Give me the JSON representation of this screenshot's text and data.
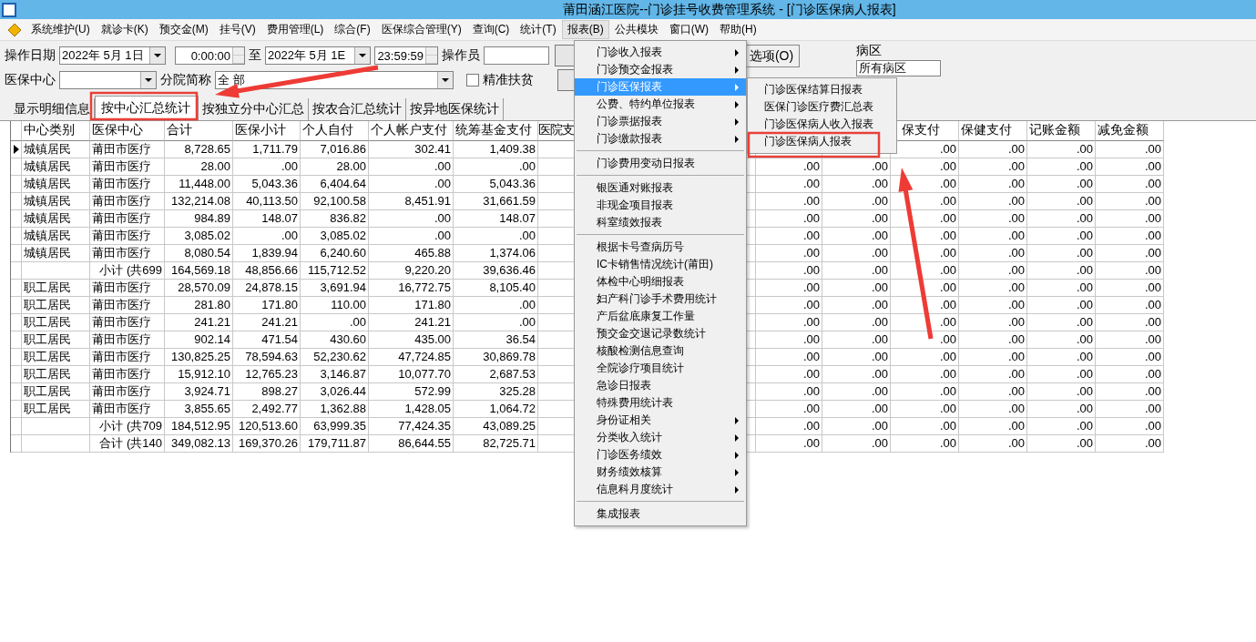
{
  "window": {
    "title": "莆田涵江医院--门诊挂号收费管理系统 - [门诊医保病人报表]"
  },
  "menubar": [
    {
      "label": "系统维护(U)",
      "selected": false
    },
    {
      "label": "就诊卡(K)",
      "selected": false
    },
    {
      "label": "预交金(M)",
      "selected": false
    },
    {
      "label": "挂号(V)",
      "selected": false
    },
    {
      "label": "费用管理(L)",
      "selected": false
    },
    {
      "label": "综合(F)",
      "selected": false
    },
    {
      "label": "医保综合管理(Y)",
      "selected": false
    },
    {
      "label": "查询(C)",
      "selected": false
    },
    {
      "label": "统计(T)",
      "selected": false
    },
    {
      "label": "报表(B)",
      "selected": true
    },
    {
      "label": "公共模块",
      "selected": false
    },
    {
      "label": "窗口(W)",
      "selected": false
    },
    {
      "label": "帮助(H)",
      "selected": false
    }
  ],
  "filters": {
    "date_label": "操作日期",
    "date_from": "2022年  5月  1日",
    "time_from": "0:00:00",
    "to_label": "至",
    "date_to": "2022年  5月  1E",
    "time_to": "23:59:59",
    "operator_label": "操作员",
    "center_label": "医保中心",
    "branch_label": "分院简称",
    "branch_value": "全  部",
    "poverty_label": "精准扶贫",
    "poverty_checked": false,
    "options_button": "选项(O)",
    "ward_label": "病区",
    "ward_value": "所有病区"
  },
  "tabs": [
    {
      "label": "显示明细信息",
      "selected": false
    },
    {
      "label": "按中心汇总统计",
      "selected": true
    },
    {
      "label": "按独立分中心汇总",
      "selected": false
    },
    {
      "label": "按农合汇总统计",
      "selected": false
    },
    {
      "label": "按异地医保统计",
      "selected": false
    }
  ],
  "table": {
    "columns": [
      "中心类别",
      "医保中心",
      "合计",
      "医保小计",
      "个人自付",
      "个人帐户支付",
      "统筹基金支付",
      "医院支"
    ],
    "right_columns": [
      "保支付",
      "保健支付",
      "记账金额",
      "减免金额"
    ],
    "rows": [
      {
        "current": true,
        "category": "城镇居民",
        "center": "莆田市医疗",
        "values": [
          "8,728.65",
          "1,711.79",
          "7,016.86",
          "302.41",
          "1,409.38"
        ],
        "right": [
          ".00",
          ".00",
          ".00",
          ".00"
        ]
      },
      {
        "current": false,
        "category": "城镇居民",
        "center": "莆田市医疗",
        "values": [
          "28.00",
          ".00",
          "28.00",
          ".00",
          ".00"
        ],
        "right": [
          ".00",
          ".00",
          ".00",
          ".00",
          ".00",
          ".00"
        ]
      },
      {
        "current": false,
        "category": "城镇居民",
        "center": "莆田市医疗",
        "values": [
          "11,448.00",
          "5,043.36",
          "6,404.64",
          ".00",
          "5,043.36"
        ],
        "right": [
          ".00",
          ".00",
          ".00",
          ".00",
          ".00",
          ".00"
        ]
      },
      {
        "current": false,
        "category": "城镇居民",
        "center": "莆田市医疗",
        "values": [
          "132,214.08",
          "40,113.50",
          "92,100.58",
          "8,451.91",
          "31,661.59"
        ],
        "right": [
          ".00",
          ".00",
          ".00",
          ".00",
          ".00",
          ".00"
        ]
      },
      {
        "current": false,
        "category": "城镇居民",
        "center": "莆田市医疗",
        "values": [
          "984.89",
          "148.07",
          "836.82",
          ".00",
          "148.07"
        ],
        "right": [
          ".00",
          ".00",
          ".00",
          ".00",
          ".00",
          ".00"
        ]
      },
      {
        "current": false,
        "category": "城镇居民",
        "center": "莆田市医疗",
        "values": [
          "3,085.02",
          ".00",
          "3,085.02",
          ".00",
          ".00"
        ],
        "right": [
          ".00",
          ".00",
          ".00",
          ".00",
          ".00",
          ".00"
        ]
      },
      {
        "current": false,
        "category": "城镇居民",
        "center": "莆田市医疗",
        "values": [
          "8,080.54",
          "1,839.94",
          "6,240.60",
          "465.88",
          "1,374.06"
        ],
        "right": [
          ".00",
          ".00",
          ".00",
          ".00",
          ".00",
          ".00"
        ]
      },
      {
        "current": false,
        "center": "小计 (共699",
        "values": [
          "164,569.18",
          "48,856.66",
          "115,712.52",
          "9,220.20",
          "39,636.46"
        ],
        "right": [
          ".00",
          ".00",
          ".00",
          ".00",
          ".00",
          ".00"
        ]
      },
      {
        "current": false,
        "category": "职工居民",
        "center": "莆田市医疗",
        "values": [
          "28,570.09",
          "24,878.15",
          "3,691.94",
          "16,772.75",
          "8,105.40"
        ],
        "right": [
          ".00",
          ".00",
          ".00",
          ".00",
          ".00",
          ".00"
        ]
      },
      {
        "current": false,
        "category": "职工居民",
        "center": "莆田市医疗",
        "values": [
          "281.80",
          "171.80",
          "110.00",
          "171.80",
          ".00"
        ],
        "right": [
          ".00",
          ".00",
          ".00",
          ".00",
          ".00",
          ".00"
        ]
      },
      {
        "current": false,
        "category": "职工居民",
        "center": "莆田市医疗",
        "values": [
          "241.21",
          "241.21",
          ".00",
          "241.21",
          ".00"
        ],
        "right": [
          ".00",
          ".00",
          ".00",
          ".00",
          ".00",
          ".00"
        ]
      },
      {
        "current": false,
        "category": "职工居民",
        "center": "莆田市医疗",
        "values": [
          "902.14",
          "471.54",
          "430.60",
          "435.00",
          "36.54"
        ],
        "right": [
          ".00",
          ".00",
          ".00",
          ".00",
          ".00",
          ".00"
        ]
      },
      {
        "current": false,
        "category": "职工居民",
        "center": "莆田市医疗",
        "values": [
          "130,825.25",
          "78,594.63",
          "52,230.62",
          "47,724.85",
          "30,869.78"
        ],
        "right": [
          ".00",
          ".00",
          ".00",
          ".00",
          ".00",
          ".00"
        ]
      },
      {
        "current": false,
        "category": "职工居民",
        "center": "莆田市医疗",
        "values": [
          "15,912.10",
          "12,765.23",
          "3,146.87",
          "10,077.70",
          "2,687.53"
        ],
        "right": [
          ".00",
          ".00",
          ".00",
          ".00",
          ".00",
          ".00"
        ]
      },
      {
        "current": false,
        "category": "职工居民",
        "center": "莆田市医疗",
        "values": [
          "3,924.71",
          "898.27",
          "3,026.44",
          "572.99",
          "325.28"
        ],
        "right": [
          ".00",
          ".00",
          ".00",
          ".00",
          ".00",
          ".00"
        ]
      },
      {
        "current": false,
        "category": "职工居民",
        "center": "莆田市医疗",
        "values": [
          "3,855.65",
          "2,492.77",
          "1,362.88",
          "1,428.05",
          "1,064.72"
        ],
        "right": [
          ".00",
          ".00",
          ".00",
          ".00",
          ".00",
          ".00"
        ]
      },
      {
        "current": false,
        "center": "小计 (共709",
        "values": [
          "184,512.95",
          "120,513.60",
          "63,999.35",
          "77,424.35",
          "43,089.25"
        ],
        "right": [
          ".00",
          ".00",
          ".00",
          ".00",
          ".00",
          ".00"
        ]
      },
      {
        "current": false,
        "center": "合计 (共140",
        "values": [
          "349,082.13",
          "169,370.26",
          "179,711.87",
          "86,644.55",
          "82,725.71"
        ],
        "right": [
          ".00",
          ".00",
          ".00",
          ".00",
          ".00",
          ".00"
        ]
      }
    ]
  },
  "menu": [
    {
      "kind": "item",
      "label": "门诊收入报表",
      "submenu": true,
      "selected": false
    },
    {
      "kind": "item",
      "label": "门诊预交金报表",
      "submenu": true,
      "selected": false
    },
    {
      "kind": "item",
      "label": "门诊医保报表",
      "submenu": true,
      "selected": true
    },
    {
      "kind": "item",
      "label": "公费、特约单位报表",
      "submenu": true,
      "selected": false
    },
    {
      "kind": "item",
      "label": "门诊票据报表",
      "submenu": true,
      "selected": false
    },
    {
      "kind": "item",
      "label": "门诊缴款报表",
      "submenu": true,
      "selected": false
    },
    {
      "kind": "separator"
    },
    {
      "kind": "item",
      "label": "门诊费用变动日报表",
      "submenu": false,
      "selected": false
    },
    {
      "kind": "separator"
    },
    {
      "kind": "item",
      "label": "银医通对账报表",
      "submenu": false,
      "selected": false
    },
    {
      "kind": "item",
      "label": "非现金项目报表",
      "submenu": false,
      "selected": false
    },
    {
      "kind": "item",
      "label": "科室绩效报表",
      "submenu": false,
      "selected": false
    },
    {
      "kind": "separator"
    },
    {
      "kind": "item",
      "label": "根据卡号查病历号",
      "submenu": false,
      "selected": false
    },
    {
      "kind": "item",
      "label": "IC卡销售情况统计(莆田)",
      "submenu": false,
      "selected": false
    },
    {
      "kind": "item",
      "label": "体检中心明细报表",
      "submenu": false,
      "selected": false
    },
    {
      "kind": "item",
      "label": "妇产科门诊手术费用统计",
      "submenu": false,
      "selected": false
    },
    {
      "kind": "item",
      "label": "产后盆底康复工作量",
      "submenu": false,
      "selected": false
    },
    {
      "kind": "item",
      "label": "预交金交退记录数统计",
      "submenu": false,
      "selected": false
    },
    {
      "kind": "item",
      "label": "核酸检测信息查询",
      "submenu": false,
      "selected": false
    },
    {
      "kind": "item",
      "label": "全院诊疗项目统计",
      "submenu": false,
      "selected": false
    },
    {
      "kind": "item",
      "label": "急诊日报表",
      "submenu": false,
      "selected": false
    },
    {
      "kind": "item",
      "label": "特殊费用统计表",
      "submenu": false,
      "selected": false
    },
    {
      "kind": "item",
      "label": "身份证相关",
      "submenu": true,
      "selected": false
    },
    {
      "kind": "item",
      "label": "分类收入统计",
      "submenu": true,
      "selected": false
    },
    {
      "kind": "item",
      "label": "门诊医务绩效",
      "submenu": true,
      "selected": false
    },
    {
      "kind": "item",
      "label": "财务绩效核算",
      "submenu": true,
      "selected": false
    },
    {
      "kind": "item",
      "label": "信息科月度统计",
      "submenu": true,
      "selected": false
    },
    {
      "kind": "separator"
    },
    {
      "kind": "item",
      "label": "集成报表",
      "submenu": false,
      "selected": false
    }
  ],
  "submenu": [
    {
      "label": "门诊医保结算日报表",
      "selected": false
    },
    {
      "label": "医保门诊医疗费汇总表",
      "selected": false
    },
    {
      "label": "门诊医保病人收入报表",
      "selected": false
    },
    {
      "label": "门诊医保病人报表",
      "selected": false
    }
  ]
}
